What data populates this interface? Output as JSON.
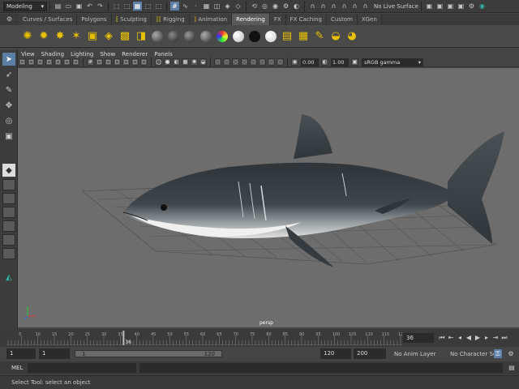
{
  "statusline": {
    "mode": "Modeling",
    "live_surface": "No Live Surface"
  },
  "shelf_tabs": [
    {
      "label": "Curves / Surfaces",
      "active": false
    },
    {
      "label": "Polygons",
      "active": false
    },
    {
      "label": "Sculpting",
      "active": false
    },
    {
      "label": "Rigging",
      "active": false
    },
    {
      "label": "Animation",
      "active": false
    },
    {
      "label": "Rendering",
      "active": true
    },
    {
      "label": "FX",
      "active": false
    },
    {
      "label": "FX Caching",
      "active": false
    },
    {
      "label": "Custom",
      "active": false
    },
    {
      "label": "XGen",
      "active": false
    }
  ],
  "panel_menu": [
    "View",
    "Shading",
    "Lighting",
    "Show",
    "Renderer",
    "Panels"
  ],
  "panel_toolbar": {
    "exposure": "0.00",
    "gamma": "1.00",
    "color_space": "sRGB gamma"
  },
  "viewport": {
    "camera": "persp",
    "background": "#6d6d6d"
  },
  "timeline": {
    "tick_labels": [
      "5",
      "10",
      "15",
      "20",
      "25",
      "30",
      "35",
      "40",
      "45",
      "50",
      "55",
      "60",
      "65",
      "70",
      "75",
      "80",
      "85",
      "90",
      "95",
      "100",
      "105",
      "110",
      "115",
      "120"
    ],
    "playhead_label": "36",
    "current_frame": "36"
  },
  "range": {
    "start": "1",
    "playback_start": "1",
    "slider_start": "1",
    "slider_end": "120",
    "playback_end": "120",
    "end": "200",
    "anim_layer": "No Anim Layer",
    "character_set": "No Character Set"
  },
  "command": {
    "language": "MEL"
  },
  "help": {
    "text": "Select Tool: select an object"
  }
}
